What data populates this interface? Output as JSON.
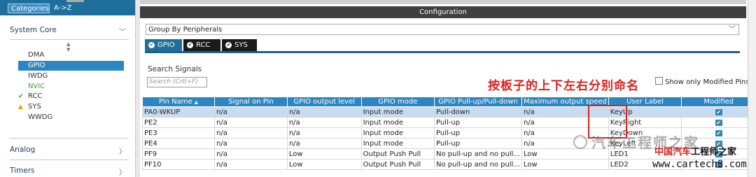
{
  "left_panel": {
    "tabs": {
      "categories": "Categories",
      "az": "A->Z"
    },
    "sections": {
      "system_core": "System Core",
      "analog": "Analog",
      "timers": "Timers"
    },
    "items": [
      {
        "label": "DMA",
        "status": ""
      },
      {
        "label": "GPIO",
        "status": ""
      },
      {
        "label": "IWDG",
        "status": ""
      },
      {
        "label": "NVIC",
        "status": ""
      },
      {
        "label": "RCC",
        "status": "ok"
      },
      {
        "label": "SYS",
        "status": "warn"
      },
      {
        "label": "WWDG",
        "status": ""
      }
    ],
    "status_glyphs": {
      "ok": "✔",
      "warn": "▲"
    }
  },
  "config": {
    "title": "Configuration",
    "group_select": "Group By Peripherals",
    "tabs": [
      {
        "label": "GPIO",
        "active": true
      },
      {
        "label": "RCC",
        "active": false
      },
      {
        "label": "SYS",
        "active": false
      }
    ],
    "search_label": "Search Signals",
    "search_placeholder": "Search (Crtl+F)",
    "show_modified_label": "Show only Modified Pins",
    "annotation": "按板子的上下左右分别命名"
  },
  "table": {
    "headers": [
      "Pin Name",
      "Signal on Pin",
      "GPIO output level",
      "GPIO mode",
      "GPIO Pull-up/Pull-down",
      "Maximum output speed",
      "User Label",
      "Modified"
    ],
    "rows": [
      [
        "PA0-WKUP",
        "n/a",
        "n/a",
        "Input mode",
        "Pull-down",
        "n/a",
        "KeyUp",
        true
      ],
      [
        "PE2",
        "n/a",
        "n/a",
        "Input mode",
        "Pull-up",
        "n/a",
        "KeyRight",
        true
      ],
      [
        "PE3",
        "n/a",
        "n/a",
        "Input mode",
        "Pull-up",
        "n/a",
        "KeyDown",
        true
      ],
      [
        "PE4",
        "n/a",
        "n/a",
        "Input mode",
        "Pull-up",
        "n/a",
        "KeyLeft",
        true
      ],
      [
        "PF9",
        "n/a",
        "Low",
        "Output Push Pull",
        "No pull-up and no pull...",
        "Low",
        "LED1",
        true
      ],
      [
        "PF10",
        "n/a",
        "Low",
        "Output Push Pull",
        "No pull-up and no pull...",
        "Low",
        "LED2",
        true
      ]
    ]
  },
  "watermark": {
    "wechat": "汽车工程师之家",
    "brand_part1": "中国汽车",
    "brand_part2": "工程师之家",
    "url": "www.cartech8.com"
  },
  "colors": {
    "accent": "#2e86c1",
    "annotation": "#e0201c",
    "header_bar": "#3f3f3f"
  }
}
